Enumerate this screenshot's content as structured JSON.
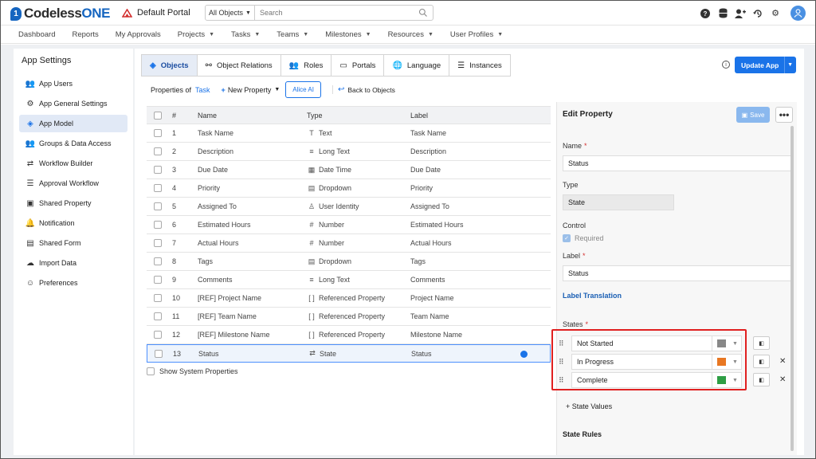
{
  "brand": {
    "name_part1": "Codeless",
    "name_part2": "ONE",
    "logo_letter": "1"
  },
  "portal": {
    "name": "Default Portal"
  },
  "search": {
    "scope": "All Objects",
    "placeholder": "Search"
  },
  "top_icons": [
    "help-icon",
    "database-icon",
    "add-user-icon",
    "history-icon",
    "gear-icon",
    "user-avatar-icon"
  ],
  "nav": [
    {
      "label": "Dashboard",
      "dropdown": false
    },
    {
      "label": "Reports",
      "dropdown": false
    },
    {
      "label": "My Approvals",
      "dropdown": false
    },
    {
      "label": "Projects",
      "dropdown": true
    },
    {
      "label": "Tasks",
      "dropdown": true
    },
    {
      "label": "Teams",
      "dropdown": true
    },
    {
      "label": "Milestones",
      "dropdown": true
    },
    {
      "label": "Resources",
      "dropdown": true
    },
    {
      "label": "User Profiles",
      "dropdown": true
    }
  ],
  "sidebar": {
    "title": "App Settings",
    "items": [
      {
        "label": "App Users",
        "icon": "users-icon",
        "active": false
      },
      {
        "label": "App General Settings",
        "icon": "gear-icon",
        "active": false
      },
      {
        "label": "App Model",
        "icon": "cube-icon",
        "active": true
      },
      {
        "label": "Groups & Data Access",
        "icon": "group-icon",
        "active": false
      },
      {
        "label": "Workflow Builder",
        "icon": "arrows-icon",
        "active": false
      },
      {
        "label": "Approval Workflow",
        "icon": "checklist-icon",
        "active": false
      },
      {
        "label": "Shared Property",
        "icon": "shared-property-icon",
        "active": false
      },
      {
        "label": "Notification",
        "icon": "bell-icon",
        "active": false
      },
      {
        "label": "Shared Form",
        "icon": "form-icon",
        "active": false
      },
      {
        "label": "Import Data",
        "icon": "cloud-upload-icon",
        "active": false
      },
      {
        "label": "Preferences",
        "icon": "preferences-icon",
        "active": false
      }
    ]
  },
  "tabs": [
    {
      "label": "Objects",
      "icon": "cube-icon",
      "active": true
    },
    {
      "label": "Object Relations",
      "icon": "relations-icon",
      "active": false
    },
    {
      "label": "Roles",
      "icon": "roles-icon",
      "active": false
    },
    {
      "label": "Portals",
      "icon": "monitor-icon",
      "active": false
    },
    {
      "label": "Language",
      "icon": "globe-icon",
      "active": false
    },
    {
      "label": "Instances",
      "icon": "database-icon",
      "active": false
    }
  ],
  "update_button": {
    "label": "Update App"
  },
  "properties_bar": {
    "prefix": "Properties of",
    "object": "Task",
    "new_property": "New Property",
    "alice": "Alice AI",
    "back": "Back to Objects"
  },
  "table": {
    "headers": {
      "num": "#",
      "name": "Name",
      "type": "Type",
      "label": "Label"
    },
    "rows": [
      {
        "num": "1",
        "name": "Task Name",
        "type": "Text",
        "type_glyph": "T",
        "label": "Task Name"
      },
      {
        "num": "2",
        "name": "Description",
        "type": "Long Text",
        "type_glyph": "≡",
        "label": "Description"
      },
      {
        "num": "3",
        "name": "Due Date",
        "type": "Date Time",
        "type_glyph": "▦",
        "label": "Due Date"
      },
      {
        "num": "4",
        "name": "Priority",
        "type": "Dropdown",
        "type_glyph": "▤",
        "label": "Priority"
      },
      {
        "num": "5",
        "name": "Assigned To",
        "type": "User Identity",
        "type_glyph": "♙",
        "label": "Assigned To"
      },
      {
        "num": "6",
        "name": "Estimated Hours",
        "type": "Number",
        "type_glyph": "#",
        "label": "Estimated Hours"
      },
      {
        "num": "7",
        "name": "Actual Hours",
        "type": "Number",
        "type_glyph": "#",
        "label": "Actual Hours"
      },
      {
        "num": "8",
        "name": "Tags",
        "type": "Dropdown",
        "type_glyph": "▤",
        "label": "Tags"
      },
      {
        "num": "9",
        "name": "Comments",
        "type": "Long Text",
        "type_glyph": "≡",
        "label": "Comments"
      },
      {
        "num": "10",
        "name": "[REF] Project Name",
        "type": "Referenced Property",
        "type_glyph": "[ ]",
        "label": "Project Name"
      },
      {
        "num": "11",
        "name": "[REF] Team Name",
        "type": "Referenced Property",
        "type_glyph": "[ ]",
        "label": "Team Name"
      },
      {
        "num": "12",
        "name": "[REF] Milestone Name",
        "type": "Referenced Property",
        "type_glyph": "[ ]",
        "label": "Milestone Name"
      },
      {
        "num": "13",
        "name": "Status",
        "type": "State",
        "type_glyph": "⇄",
        "label": "Status",
        "selected": true
      }
    ],
    "show_system": "Show System Properties"
  },
  "edit_property": {
    "title": "Edit Property",
    "save": "Save",
    "more": "•••",
    "name_label": "Name",
    "name_value": "Status",
    "type_label": "Type",
    "type_value": "State",
    "control_label": "Control",
    "required_label": "Required",
    "label_label": "Label",
    "label_value": "Status",
    "label_translation": "Label Translation",
    "states_label": "States",
    "states": [
      {
        "name": "Not Started",
        "color": "#888888",
        "removable": false
      },
      {
        "name": "In Progress",
        "color": "#e87722",
        "removable": true
      },
      {
        "name": "Complete",
        "color": "#2e9e44",
        "removable": true
      }
    ],
    "add_state": "+ State Values",
    "state_rules": "State Rules"
  },
  "colors": {
    "accent": "#1a73e8",
    "highlight": "#e02020"
  }
}
